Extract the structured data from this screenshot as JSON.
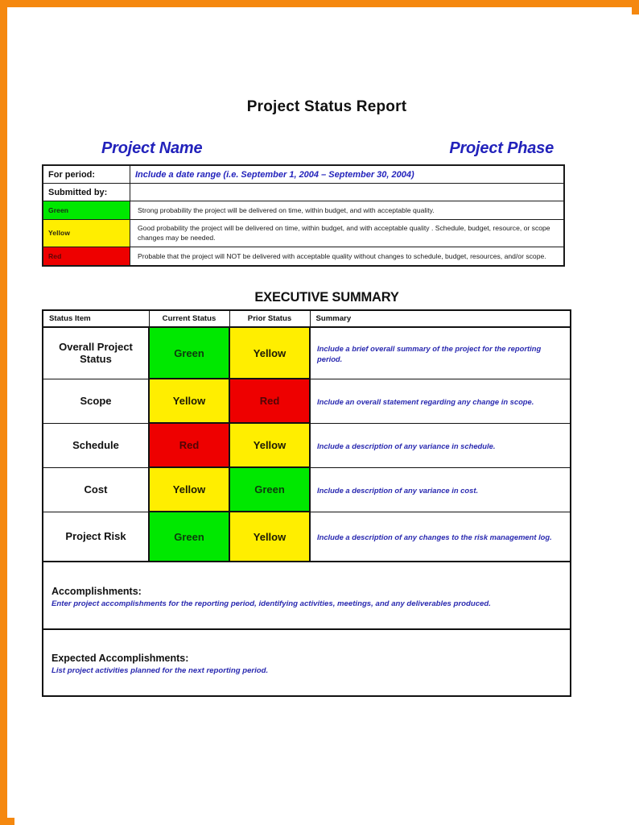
{
  "document": {
    "title": "Project Status Report",
    "project_name_heading": "Project Name",
    "project_phase_heading": "Project Phase",
    "executive_summary_heading": "EXECUTIVE SUMMARY"
  },
  "info_table": {
    "for_period_label": "For period:",
    "for_period_value": "Include a date range (i.e. September 1, 2004 – September 30, 2004)",
    "submitted_by_label": "Submitted by:",
    "submitted_by_value": "",
    "legend": [
      {
        "swatch_label": "Green",
        "color": "#00e800",
        "description": "Strong probability  the project will be delivered on time, within budget, and with acceptable quality."
      },
      {
        "swatch_label": "Yellow",
        "color": "#ffee00",
        "description": "Good probability the project will be delivered on time, within budget, and with acceptable quality . Schedule, budget, resource, or scope changes may be needed."
      },
      {
        "swatch_label": "Red",
        "color": "#ee0000",
        "description": "Probable that the project will NOT be delivered with acceptable quality without changes to schedule, budget, resources, and/or scope."
      }
    ]
  },
  "exec_table": {
    "headers": {
      "status_item": "Status Item",
      "current_status": "Current Status",
      "prior_status": "Prior Status",
      "summary": "Summary"
    },
    "rows": [
      {
        "item": "Overall Project Status",
        "current": "Green",
        "current_color": "#00e800",
        "prior": "Yellow",
        "prior_color": "#ffee00",
        "summary": "Include a brief overall summary of the project for the reporting period."
      },
      {
        "item": "Scope",
        "current": "Yellow",
        "current_color": "#ffee00",
        "prior": "Red",
        "prior_color": "#ee0000",
        "summary": "Include an overall statement regarding any change in scope."
      },
      {
        "item": "Schedule",
        "current": "Red",
        "current_color": "#ee0000",
        "prior": "Yellow",
        "prior_color": "#ffee00",
        "summary": "Include a description of any variance in schedule."
      },
      {
        "item": "Cost",
        "current": "Yellow",
        "current_color": "#ffee00",
        "prior": "Green",
        "prior_color": "#00e800",
        "summary": "Include a description of any variance in cost."
      },
      {
        "item": "Project Risk",
        "current": "Green",
        "current_color": "#00e800",
        "prior": "Yellow",
        "prior_color": "#ffee00",
        "summary": "Include a description of any changes to the risk management log."
      }
    ],
    "accomplishments": {
      "title": "Accomplishments:",
      "body": "Enter project accomplishments for the reporting period, identifying activities, meetings, and any deliverables produced."
    },
    "expected_accomplishments": {
      "title": "Expected Accomplishments:",
      "body": "List project activities planned for the next reporting period."
    }
  },
  "theme": {
    "page_border": "#f5880f",
    "heading_blue": "#2222bb",
    "body_blue": "#2a2ab0",
    "ink": "#111111"
  }
}
